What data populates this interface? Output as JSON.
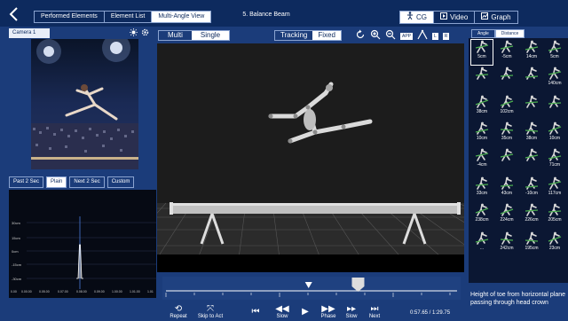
{
  "header": {
    "back_icon": "chevron-left-icon",
    "tabs": [
      {
        "label": "Performed Elements",
        "active": false
      },
      {
        "label": "Element List",
        "active": false
      },
      {
        "label": "Multi-Angle View",
        "active": true
      }
    ],
    "title": "5. Balance Beam",
    "views": [
      {
        "label": "CG",
        "icon": "cg-figure-icon",
        "active": true
      },
      {
        "label": "Video",
        "icon": "video-icon",
        "active": false
      },
      {
        "label": "Graph",
        "icon": "graph-icon",
        "active": false
      }
    ]
  },
  "left_panel": {
    "camera_label": "Camera 1",
    "camera_icons": [
      "brightness-icon",
      "settings-icon"
    ],
    "playback_buttons": [
      {
        "label": "Past 2 Sec",
        "active": false
      },
      {
        "label": "Plain",
        "active": true
      },
      {
        "label": "Next 2 Sec",
        "active": false
      },
      {
        "label": "Custom",
        "active": false
      }
    ],
    "graph": {
      "y_ticks": [
        "30cm",
        "15cm",
        "0cm",
        "-15cm",
        "-30cm"
      ],
      "x_ticks": [
        "0.00",
        "0.00.00",
        "0.05.00",
        "0.07.00",
        "0.08.00",
        "0.09.00",
        "1.00.00",
        "1.01.00",
        "1.01"
      ]
    }
  },
  "center": {
    "mode_buttons": [
      {
        "label": "Multi",
        "active": false
      },
      {
        "label": "Single",
        "active": true
      }
    ],
    "camera_buttons": [
      {
        "label": "Tracking",
        "active": false
      },
      {
        "label": "Fixed",
        "active": true
      }
    ],
    "tools": [
      "rotate-reset-icon",
      "zoom-in-icon",
      "zoom-out-icon",
      "app-icon",
      "figure-icon",
      "lr-toggle-icon"
    ],
    "tool_labels": {
      "app": "APP",
      "l": "L",
      "r": "R"
    },
    "playback_progress": 0.66,
    "marker_position": 0.49,
    "controls": [
      {
        "label": "Repeat",
        "icon": "repeat-icon"
      },
      {
        "label": "Skip to Act",
        "icon": "skip-to-act-icon"
      },
      {
        "label": "",
        "icon": "skip-back-icon"
      },
      {
        "label": "Slow",
        "icon": "step-back-icon"
      },
      {
        "label": "",
        "icon": "play-icon"
      },
      {
        "label": "Phase",
        "icon": "step-forward-icon"
      },
      {
        "label": "Slow",
        "icon": "slow-forward-icon"
      },
      {
        "label": "Next",
        "icon": "skip-forward-icon"
      }
    ],
    "timecode": "0:57.65 / 1:29.75"
  },
  "right_panel": {
    "tabs": [
      {
        "label": "Angle",
        "active": false
      },
      {
        "label": "Distance",
        "active": true
      }
    ],
    "cells": [
      [
        "5cm",
        "-5cm",
        "14cm",
        "5cm"
      ],
      [
        "",
        "",
        "",
        "140cm"
      ],
      [
        "38cm",
        "102cm",
        "",
        ""
      ],
      [
        "10cm",
        "35cm",
        "38cm",
        "10cm"
      ],
      [
        "-4cm",
        "",
        "",
        "71cm"
      ],
      [
        "33cm",
        "43cm",
        "-10cm",
        "117cm"
      ],
      [
        "238cm",
        "224cm",
        "226cm",
        "205cm"
      ],
      [
        "...",
        "242cm",
        "195cm",
        "23cm"
      ]
    ],
    "description": "Height of toe from horizontal plane passing through head crown"
  },
  "colors": {
    "background": "#1b3c7a",
    "topbar": "#0d2a5e",
    "stage": "#1e1e1e",
    "accent_green": "#4caf50"
  }
}
